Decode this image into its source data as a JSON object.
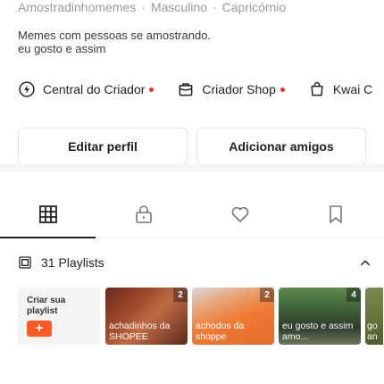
{
  "profile": {
    "tags": [
      "Amostradinhomemes",
      "Masculino",
      "Capricórnio"
    ],
    "tag_separator": "·",
    "bio_lines": [
      "Memes com pessoas se amostrando.",
      "eu gosto e assim"
    ]
  },
  "links": [
    {
      "label": "Central do Criador",
      "icon": "creator-center-icon",
      "dot": true
    },
    {
      "label": "Criador Shop",
      "icon": "shop-bag-icon",
      "dot": true
    },
    {
      "label": "Kwai C",
      "icon": "shopping-bag-icon",
      "dot": false
    }
  ],
  "actions": {
    "edit_profile": "Editar perfil",
    "add_friends": "Adicionar amigos"
  },
  "tabs": [
    {
      "name": "grid",
      "icon": "grid-icon",
      "active": true
    },
    {
      "name": "private",
      "icon": "lock-icon",
      "active": false
    },
    {
      "name": "likes",
      "icon": "heart-icon",
      "active": false
    },
    {
      "name": "saved",
      "icon": "bookmark-icon",
      "active": false
    }
  ],
  "playlists": {
    "title": "31 Playlists",
    "create_label": "Criar sua playlist",
    "create_button": "+",
    "items": [
      {
        "title": "achadinhos da SHOPEE",
        "count": "2"
      },
      {
        "title": "achodos da shoppe",
        "count": "2"
      },
      {
        "title": "eu gosto e assim amo...",
        "count": "4"
      },
      {
        "title": "go an",
        "count": ""
      }
    ]
  },
  "colors": {
    "accent": "#fe5a1f",
    "dot": "#fe2c2c"
  }
}
